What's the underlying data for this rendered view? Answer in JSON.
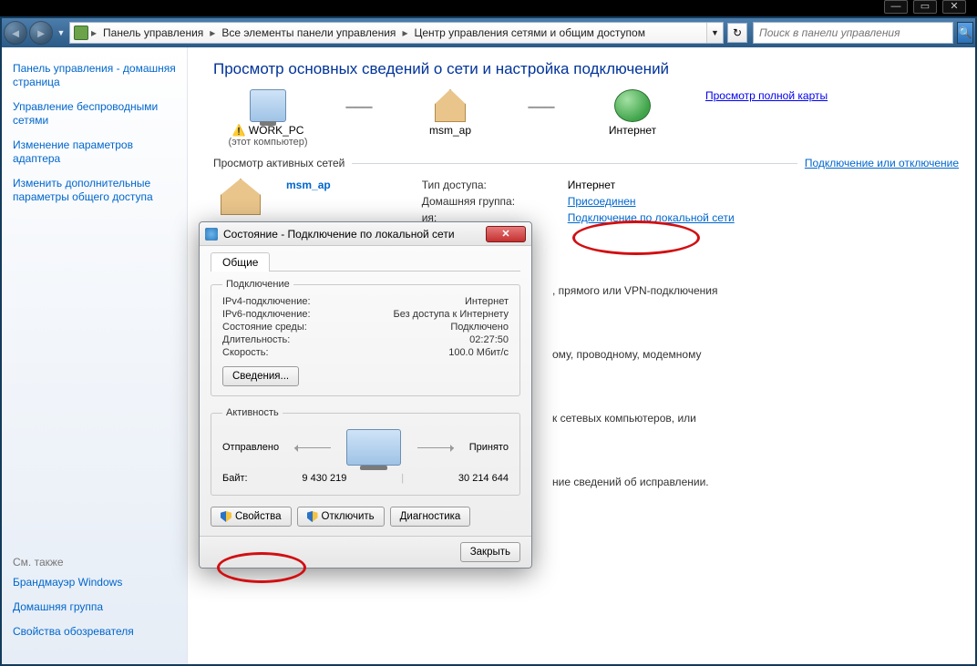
{
  "chrome": {
    "min": "—",
    "max": "▭",
    "close": "✕"
  },
  "breadcrumb": {
    "items": [
      "Панель управления",
      "Все элементы панели управления",
      "Центр управления сетями и общим доступом"
    ]
  },
  "search_placeholder": "Поиск в панели управления",
  "sidebar": {
    "home": "Панель управления - домашняя страница",
    "links": [
      "Управление беспроводными сетями",
      "Изменение параметров адаптера",
      "Изменить дополнительные параметры общего доступа"
    ],
    "seealso_hdr": "См. также",
    "seealso": [
      "Брандмауэр Windows",
      "Домашняя группа",
      "Свойства обозревателя"
    ]
  },
  "main": {
    "title": "Просмотр основных сведений о сети и настройка подключений",
    "fullmap": "Просмотр полной карты",
    "nodes": {
      "pc": "WORK_PC",
      "pc_sub": "(этот компьютер)",
      "net": "msm_ap",
      "inet": "Интернет"
    },
    "active_hdr": "Просмотр активных сетей",
    "conn_toggle": "Подключение или отключение",
    "netname": "msm_ap",
    "info": {
      "access_lbl": "Тип доступа:",
      "access_val": "Интернет",
      "hg_lbl": "Домашняя группа:",
      "hg_val": "Присоединен",
      "layer_lbl": "ия:",
      "layer_val": "Подключение по локальной сети"
    },
    "frag1": ", прямого или VPN-подключения",
    "frag2": "ому, проводному, модемному",
    "frag3": "к сетевых компьютеров, или",
    "frag4": "ние сведений об исправлении."
  },
  "dialog": {
    "title": "Состояние - Подключение по локальной сети",
    "tab": "Общие",
    "grp_conn": "Подключение",
    "rows": [
      {
        "k": "IPv4-подключение:",
        "v": "Интернет"
      },
      {
        "k": "IPv6-подключение:",
        "v": "Без доступа к Интернету"
      },
      {
        "k": "Состояние среды:",
        "v": "Подключено"
      },
      {
        "k": "Длительность:",
        "v": "02:27:50"
      },
      {
        "k": "Скорость:",
        "v": "100.0 Мбит/с"
      }
    ],
    "details": "Сведения...",
    "grp_act": "Активность",
    "sent": "Отправлено",
    "recv": "Принято",
    "bytes_lbl": "Байт:",
    "bytes_sent": "9 430 219",
    "bytes_recv": "30 214 644",
    "btn_props": "Свойства",
    "btn_disable": "Отключить",
    "btn_diag": "Диагностика",
    "btn_close": "Закрыть"
  }
}
